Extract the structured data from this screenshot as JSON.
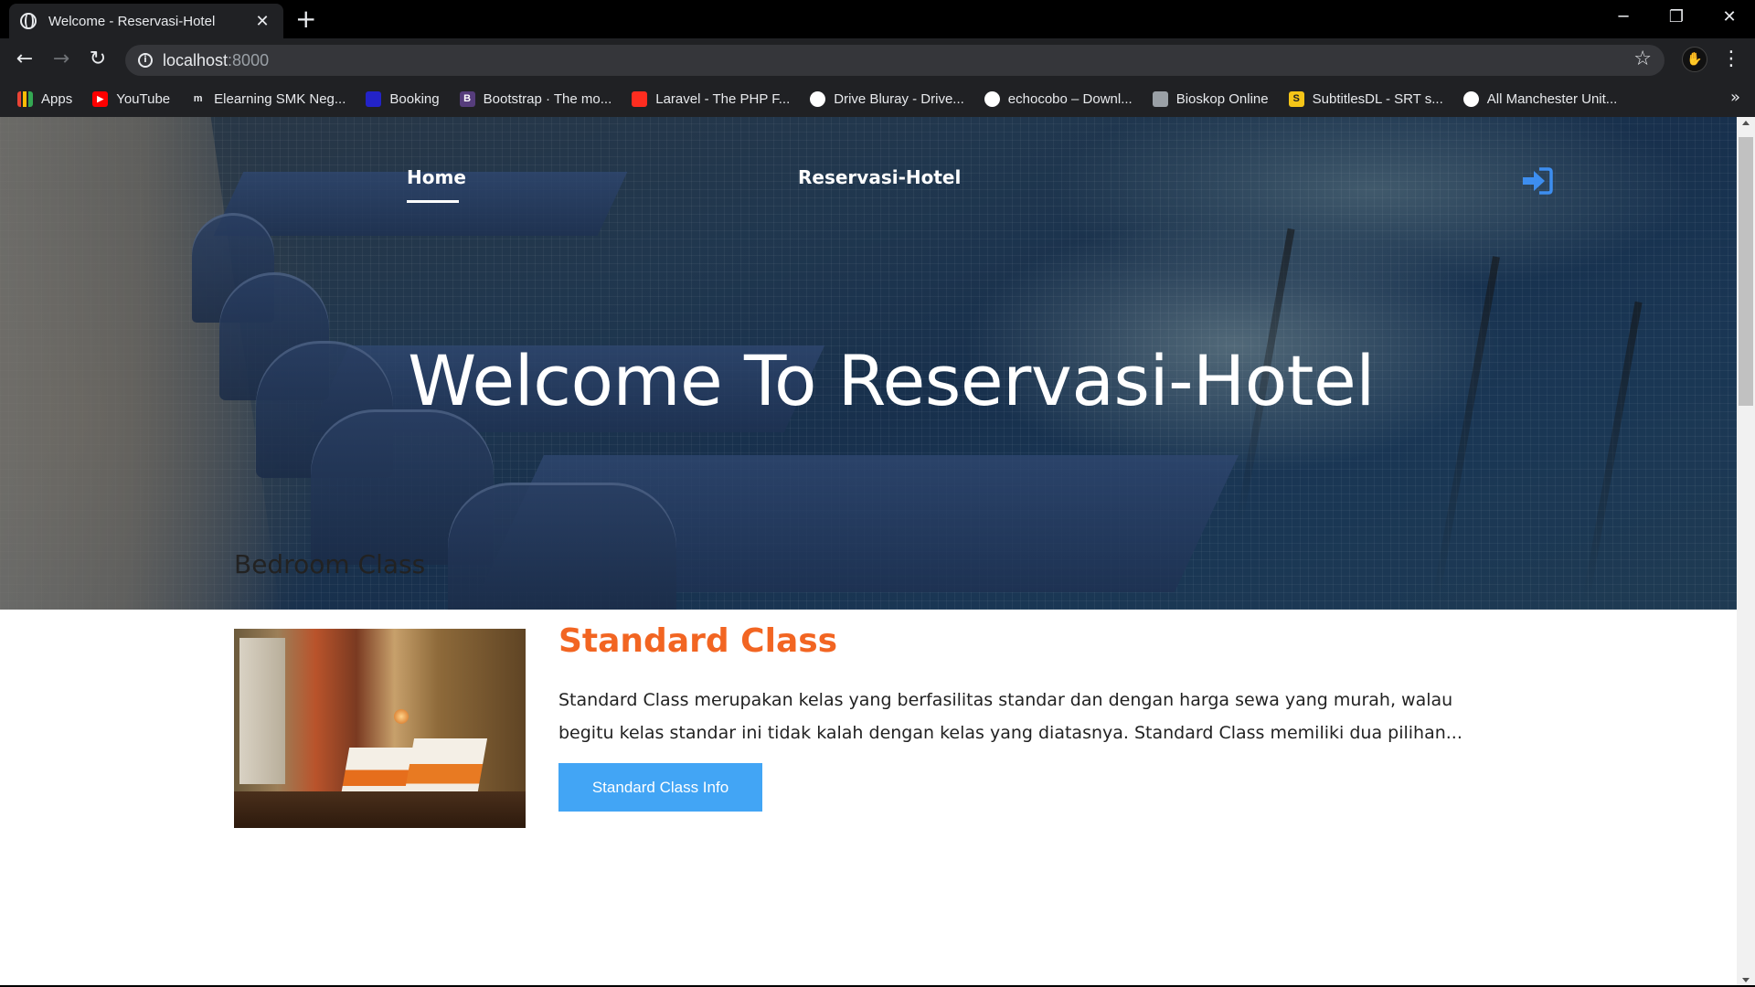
{
  "browser": {
    "tab_title": "Welcome - Reservasi-Hotel",
    "tab_close": "✕",
    "new_tab": "+",
    "window_controls": {
      "minimize": "─",
      "restore": "❐",
      "close": "✕"
    },
    "url_host": "localhost",
    "url_port": ":8000",
    "star": "☆",
    "menu": "⋮",
    "bookmarks_more": "»",
    "bookmarks": [
      {
        "label": "Apps",
        "icon": "apps-grid-icon",
        "color": "#ea4335"
      },
      {
        "label": "YouTube",
        "icon": "youtube-icon",
        "color": "#ff0000"
      },
      {
        "label": "Elearning SMK Neg...",
        "icon": "elearning-icon",
        "color": "#202124"
      },
      {
        "label": "Booking",
        "icon": "booking-icon",
        "color": "#2323c8"
      },
      {
        "label": "Bootstrap · The mo...",
        "icon": "bootstrap-icon",
        "color": "#563d7c"
      },
      {
        "label": "Laravel - The PHP F...",
        "icon": "laravel-icon",
        "color": "#ff2d20"
      },
      {
        "label": "Drive Bluray - Drive...",
        "icon": "drive-bluray-icon",
        "color": "#ffffff"
      },
      {
        "label": "echocobo – Downl...",
        "icon": "echocobo-icon",
        "color": "#ffffff"
      },
      {
        "label": "Bioskop Online",
        "icon": "bioskop-icon",
        "color": "#9aa0a6"
      },
      {
        "label": "SubtitlesDL - SRT s...",
        "icon": "subtitles-icon",
        "color": "#f5c518"
      },
      {
        "label": "All Manchester Unit...",
        "icon": "man-utd-icon",
        "color": "#ffffff"
      }
    ]
  },
  "hero": {
    "nav_home": "Home",
    "brand": "Reservasi-Hotel",
    "title": "Welcome To Reservasi-Hotel",
    "login_icon_color": "#3d8ef0"
  },
  "content": {
    "section_title": "Bedroom Class",
    "room": {
      "title": "Standard Class",
      "description": "Standard Class merupakan kelas yang berfasilitas standar dan dengan harga sewa yang murah, walau begitu kelas standar ini tidak kalah dengan kelas yang diatasnya. Standard Class memiliki dua pilihan...",
      "button": "Standard Class Info",
      "title_color": "#f26522",
      "button_color": "#42a5f5"
    }
  }
}
